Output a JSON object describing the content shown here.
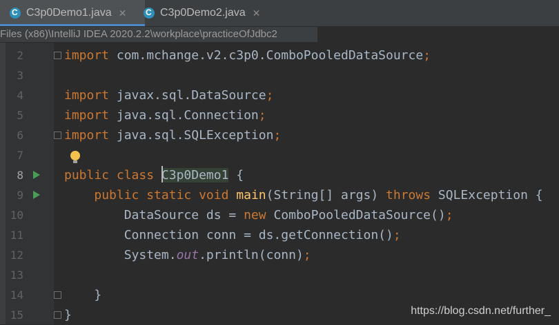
{
  "tabs": [
    {
      "label": "C3p0Demo1.java",
      "active": true
    },
    {
      "label": "C3p0Demo2.java",
      "active": false
    }
  ],
  "path_tooltip": "Files (x86)\\IntelliJ IDEA 2020.2.2\\workplace\\practiceOfJdbc2",
  "lines": [
    {
      "n": "2",
      "code": "import com.mchange.v2.c3p0.ComboPooledDataSource;"
    },
    {
      "n": "3",
      "code": ""
    },
    {
      "n": "4",
      "code": "import javax.sql.DataSource;"
    },
    {
      "n": "5",
      "code": "import java.sql.Connection;"
    },
    {
      "n": "6",
      "code": "import java.sql.SQLException;"
    },
    {
      "n": "7",
      "code": ""
    },
    {
      "n": "8",
      "code": "public class C3p0Demo1 {"
    },
    {
      "n": "9",
      "code": "    public static void main(String[] args) throws SQLException {"
    },
    {
      "n": "10",
      "code": "        DataSource ds = new ComboPooledDataSource();"
    },
    {
      "n": "11",
      "code": "        Connection conn = ds.getConnection();"
    },
    {
      "n": "12",
      "code": "        System.out.println(conn);"
    },
    {
      "n": "13",
      "code": ""
    },
    {
      "n": "14",
      "code": "    }"
    },
    {
      "n": "15",
      "code": "}"
    }
  ],
  "watermark": "https://blog.csdn.net/further_",
  "colors": {
    "keyword": "#cc7832",
    "method": "#ffc66d",
    "static_field": "#9876aa",
    "text": "#a9b7c6",
    "run": "#499c54"
  }
}
